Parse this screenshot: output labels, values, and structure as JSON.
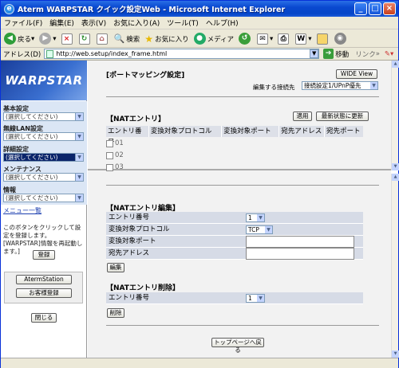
{
  "window": {
    "title": "Aterm WARPSTAR クイック設定Web - Microsoft Internet Explorer"
  },
  "menu": [
    "ファイル(F)",
    "編集(E)",
    "表示(V)",
    "お気に入り(A)",
    "ツール(T)",
    "ヘルプ(H)"
  ],
  "toolbar": {
    "back": "戻る",
    "search": "検索",
    "favorites": "お気に入り",
    "media": "メディア"
  },
  "address": {
    "label": "アドレス(D)",
    "url": "http://web.setup/index_frame.html",
    "go": "移動",
    "links": "リンク"
  },
  "sidebar": {
    "logo": "WARPSTAR",
    "groups": [
      {
        "label": "基本設定",
        "select": "(選択してください)"
      },
      {
        "label": "無線LAN設定",
        "select": "(選択してください)"
      },
      {
        "label": "詳細設定",
        "select": "(選択してください)"
      },
      {
        "label": "メンテナンス",
        "select": "(選択してください)"
      },
      {
        "label": "情報",
        "select": "(選択してください)"
      }
    ],
    "menu_list": "メニュー一覧",
    "note": "このボタンをクリックして設定を登録します。[WARPSTAR]情報を再起動します。]",
    "register": "登録",
    "aterm_station": "AtermStation",
    "customer_reg": "お客様登録",
    "close": "閉じる"
  },
  "top": {
    "title": "[ポートマッピング設定]",
    "wide_view": "WIDE View",
    "conn_label": "編集する接続先",
    "conn_select": "接続設定1/UPnP優先",
    "nat_title": "【NATエントリ】",
    "apply": "適用",
    "refresh": "最新状態に更新",
    "columns": [
      "エントリ番号",
      "変換対象プロトコル",
      "変換対象ポート",
      "宛先アドレス",
      "宛先ポート"
    ],
    "entries": [
      "01",
      "02",
      "03"
    ]
  },
  "edit": {
    "title": "【NATエントリ編集】",
    "rows": [
      {
        "label": "エントリ番号",
        "value": "1"
      },
      {
        "label": "変換対象プロトコル",
        "value": "TCP"
      },
      {
        "label": "変換対象ポート",
        "value": ""
      },
      {
        "label": "宛先アドレス",
        "value": ""
      }
    ],
    "edit_button": "編集",
    "delete_title": "【NATエントリ削除】",
    "delete_row": {
      "label": "エントリ番号",
      "value": "1"
    },
    "delete_button": "削除",
    "top_button": "トップページへ戻る"
  }
}
